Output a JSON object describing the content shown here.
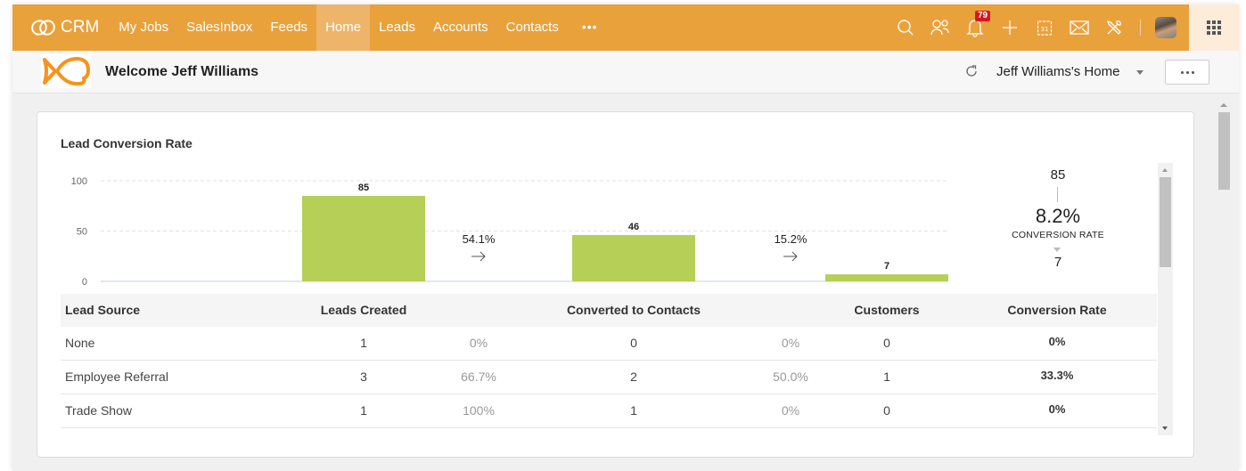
{
  "nav": {
    "logo_text": "CRM",
    "items": [
      {
        "label": "My Jobs",
        "active": false
      },
      {
        "label": "SalesInbox",
        "active": false
      },
      {
        "label": "Feeds",
        "active": false
      },
      {
        "label": "Home",
        "active": true
      },
      {
        "label": "Leads",
        "active": false
      },
      {
        "label": "Accounts",
        "active": false
      },
      {
        "label": "Contacts",
        "active": false
      }
    ],
    "more_label": "•••",
    "notification_count": "79",
    "icons": [
      "search-icon",
      "contacts-icon",
      "bell-icon",
      "plus-icon",
      "calendar-icon",
      "mail-icon",
      "setup-icon",
      "avatar",
      "apps-grid-icon"
    ],
    "calendar_day": "31",
    "accent_color": "#e9a13c"
  },
  "subheader": {
    "welcome": "Welcome Jeff Williams",
    "home_view": "Jeff Williams's Home",
    "more_label": "•••"
  },
  "card": {
    "title": "Lead Conversion Rate"
  },
  "chart_data": {
    "type": "bar",
    "title": "Lead Conversion Rate",
    "categories": [
      "Leads Created",
      "Converted to Contacts",
      "Customers"
    ],
    "values": [
      85,
      46,
      7
    ],
    "stage_rates": [
      "54.1%",
      "15.2%"
    ],
    "yticks": [
      0,
      50,
      100
    ],
    "ylim": [
      0,
      100
    ],
    "grid": true,
    "bar_color": "#b5cf57",
    "summary": {
      "top": "85",
      "rate": "8.2%",
      "label": "CONVERSION RATE",
      "bottom": "7"
    }
  },
  "table": {
    "headers": {
      "source": "Lead Source",
      "leads": "Leads Created",
      "converted": "Converted to Contacts",
      "customers": "Customers",
      "rate": "Conversion Rate"
    },
    "rows": [
      {
        "source": "None",
        "leads": "1",
        "leads_pct": "0%",
        "converted": "0",
        "converted_pct": "0%",
        "customers": "0",
        "rate": "0%"
      },
      {
        "source": "Employee Referral",
        "leads": "3",
        "leads_pct": "66.7%",
        "converted": "2",
        "converted_pct": "50.0%",
        "customers": "1",
        "rate": "33.3%"
      },
      {
        "source": "Trade Show",
        "leads": "1",
        "leads_pct": "100%",
        "converted": "1",
        "converted_pct": "0%",
        "customers": "0",
        "rate": "0%"
      }
    ]
  }
}
